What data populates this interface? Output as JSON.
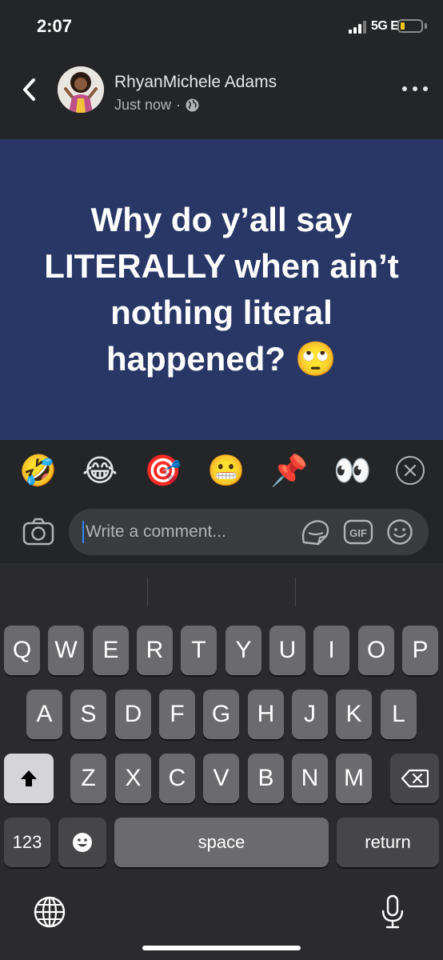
{
  "status_bar": {
    "time": "2:07",
    "network": "5G E"
  },
  "post": {
    "author": "RhyanMichele Adams",
    "timestamp": "Just now",
    "separator": "·",
    "audience_icon": "globe-icon",
    "text": "Why do y’all say LITERALLY when ain’t nothing literal happened? 🙄",
    "background_color": "#283766"
  },
  "reactions": [
    {
      "emoji": "🤣",
      "name": "rolling-laughing"
    },
    {
      "emoji": "😂",
      "name": "tears-of-joy"
    },
    {
      "emoji": "🎯",
      "name": "direct-hit"
    },
    {
      "emoji": "😬",
      "name": "grimacing"
    },
    {
      "emoji": "📌",
      "name": "pushpin"
    },
    {
      "emoji": "👀",
      "name": "eyes"
    }
  ],
  "comment": {
    "placeholder": "Write a comment..."
  },
  "keyboard": {
    "row1": [
      "Q",
      "W",
      "E",
      "R",
      "T",
      "Y",
      "U",
      "I",
      "O",
      "P"
    ],
    "row2": [
      "A",
      "S",
      "D",
      "F",
      "G",
      "H",
      "J",
      "K",
      "L"
    ],
    "row3": [
      "Z",
      "X",
      "C",
      "V",
      "B",
      "N",
      "M"
    ],
    "numbers_label": "123",
    "space_label": "space",
    "return_label": "return"
  },
  "colors": {
    "background": "#242526",
    "accent": "#2d88ff",
    "post_background": "#283766"
  }
}
